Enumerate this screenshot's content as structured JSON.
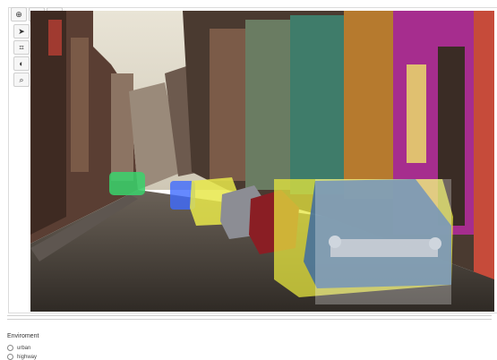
{
  "toolbar": {
    "zoom_in_icon": "⊕",
    "zoom_out_icon": "⊖",
    "fit_icon": "⤢"
  },
  "side_tools": {
    "pointer_icon": "➤",
    "polygon_icon": "⌗",
    "brush_icon": "◐",
    "search_icon": "⌕"
  },
  "environment": {
    "title": "Enviroment",
    "options": [
      "urban",
      "highway"
    ]
  }
}
